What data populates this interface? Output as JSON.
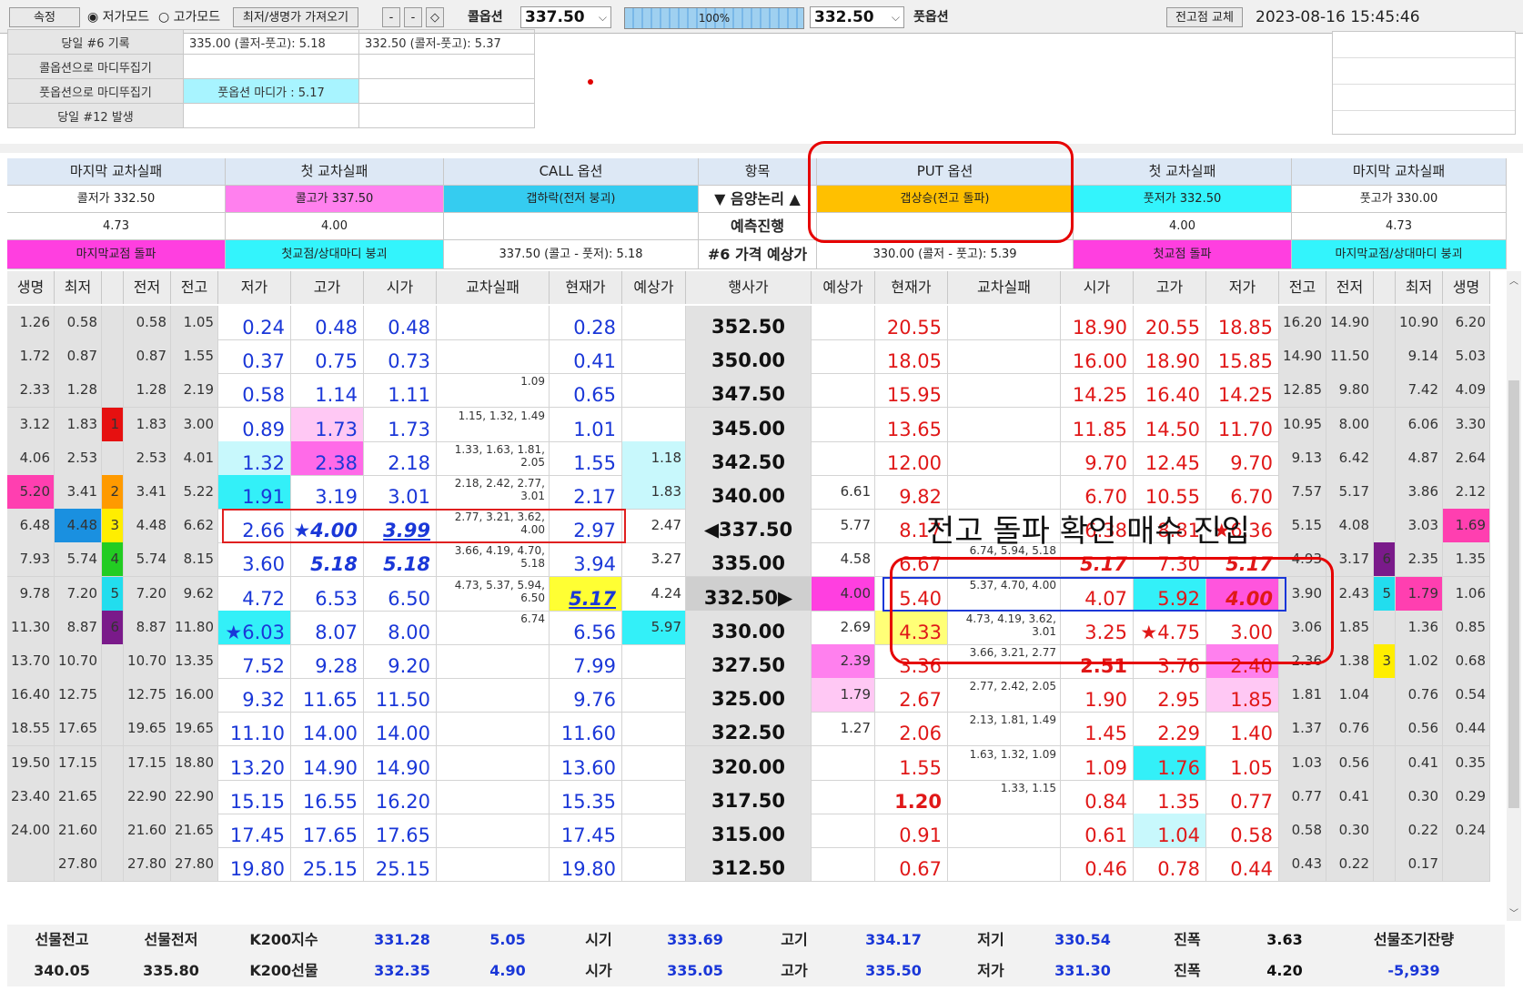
{
  "toolbar": {
    "button_left": "속정",
    "mode1": "저가모드",
    "mode2": "고가모드",
    "load_button": "최저/생명가 가져오기",
    "small_buttons": [
      "-",
      "-",
      "◇"
    ],
    "call_label": "콜옵션",
    "call_value": "337.50",
    "progress": "100%",
    "put_value": "332.50",
    "put_label": "풋옵션",
    "right_button": "전고점 교체",
    "datetime": "2023-08-16 15:45:46"
  },
  "info_table": {
    "rows": [
      {
        "label": "당일 #6 기록",
        "v1": "335.00 (콜저-풋고): 5.18",
        "v2": "332.50 (콜저-풋고): 5.37"
      },
      {
        "label": "콜옵션으로 마디뚜집기",
        "v1": "",
        "v2": ""
      },
      {
        "label": "풋옵션으로 마디뚜집기",
        "v1": "풋옵션 마디가 : 5.17",
        "v2": ""
      },
      {
        "label": "당일 #12 발생",
        "v1": "",
        "v2": ""
      }
    ]
  },
  "bands": {
    "col_titles": [
      "마지막 교차실패",
      "첫 교차실패",
      "CALL 옵션",
      "항목",
      "PUT 옵션",
      "첫 교차실패",
      "마지막 교차실패"
    ],
    "row2": [
      "콜저가 332.50",
      "콜고가 337.50",
      "갭하락(전저 붕괴)",
      "▼ 음양논리 ▲",
      "갭상승(전고 돌파)",
      "풋저가 332.50",
      "풋고가 330.00"
    ],
    "row3": [
      "4.73",
      "4.00",
      "",
      "예측진행",
      "",
      "4.00",
      "4.73"
    ],
    "row4": [
      "마지막교점 돌파",
      "첫교점/상대마디 붕괴",
      "337.50 (콜고 - 풋저): 5.18",
      "#6 가격 예상가",
      "330.00 (콜저 - 풋고): 5.39",
      "첫교점 돌파",
      "마지막교점/상대마디 붕괴"
    ]
  },
  "columns": [
    "생명",
    "최저",
    "",
    "전저",
    "전고",
    "저가",
    "고가",
    "시가",
    "교차실패",
    "현재가",
    "예상가",
    "행사가",
    "예상가",
    "현재가",
    "교차실패",
    "시가",
    "고가",
    "저가",
    "전고",
    "전저",
    "",
    "최저",
    "생명"
  ],
  "rows": [
    {
      "c_life": "1.26",
      "c_min": "0.58",
      "c_flag": "",
      "c_pl": "0.58",
      "c_ph": "1.05",
      "c_low": "0.24",
      "c_high": "0.48",
      "c_open": "0.48",
      "c_cross": "",
      "c_cur": "0.28",
      "c_exp": "",
      "strike": "352.50",
      "p_exp": "",
      "p_cur": "20.55",
      "p_cross": "",
      "p_open": "18.90",
      "p_high": "20.55",
      "p_low": "18.85",
      "p_ph": "16.20",
      "p_pl": "14.90",
      "p_flag": "",
      "p_min": "10.90",
      "p_life": "6.20"
    },
    {
      "c_life": "1.72",
      "c_min": "0.87",
      "c_flag": "",
      "c_pl": "0.87",
      "c_ph": "1.55",
      "c_low": "0.37",
      "c_high": "0.75",
      "c_open": "0.73",
      "c_cross": "",
      "c_cur": "0.41",
      "c_exp": "",
      "strike": "350.00",
      "p_exp": "",
      "p_cur": "18.05",
      "p_cross": "",
      "p_open": "16.00",
      "p_high": "18.90",
      "p_low": "15.85",
      "p_ph": "14.90",
      "p_pl": "11.50",
      "p_flag": "",
      "p_min": "9.14",
      "p_life": "5.03"
    },
    {
      "c_life": "2.33",
      "c_min": "1.28",
      "c_flag": "",
      "c_pl": "1.28",
      "c_ph": "2.19",
      "c_low": "0.58",
      "c_high": "1.14",
      "c_open": "1.11",
      "c_cross": "1.09",
      "c_cur": "0.65",
      "c_exp": "",
      "strike": "347.50",
      "p_exp": "",
      "p_cur": "15.95",
      "p_cross": "",
      "p_open": "14.25",
      "p_high": "16.40",
      "p_low": "14.25",
      "p_ph": "12.85",
      "p_pl": "9.80",
      "p_flag": "",
      "p_min": "7.42",
      "p_life": "4.09"
    },
    {
      "c_life": "3.12",
      "c_min": "1.83",
      "c_flag": "1",
      "c_pl": "1.83",
      "c_ph": "3.00",
      "c_low": "0.89",
      "c_high": "1.73",
      "c_open": "1.73",
      "c_cross": "1.15, 1.32, 1.49",
      "c_cur": "1.01",
      "c_exp": "",
      "strike": "345.00",
      "p_exp": "",
      "p_cur": "13.65",
      "p_cross": "",
      "p_open": "11.85",
      "p_high": "14.50",
      "p_low": "11.70",
      "p_ph": "10.95",
      "p_pl": "8.00",
      "p_flag": "",
      "p_min": "6.06",
      "p_life": "3.30"
    },
    {
      "c_life": "4.06",
      "c_min": "2.53",
      "c_flag": "",
      "c_pl": "2.53",
      "c_ph": "4.01",
      "c_low": "1.32",
      "c_high": "2.38",
      "c_open": "2.18",
      "c_cross": "1.33, 1.63, 1.81, 2.05",
      "c_cur": "1.55",
      "c_exp": "1.18",
      "strike": "342.50",
      "p_exp": "",
      "p_cur": "12.00",
      "p_cross": "",
      "p_open": "9.70",
      "p_high": "12.45",
      "p_low": "9.70",
      "p_ph": "9.13",
      "p_pl": "6.42",
      "p_flag": "",
      "p_min": "4.87",
      "p_life": "2.64"
    },
    {
      "c_life": "5.20",
      "c_min": "3.41",
      "c_flag": "2",
      "c_pl": "3.41",
      "c_ph": "5.22",
      "c_low": "1.91",
      "c_high": "3.19",
      "c_open": "3.01",
      "c_cross": "2.18, 2.42, 2.77, 3.01",
      "c_cur": "2.17",
      "c_exp": "1.83",
      "strike": "340.00",
      "p_exp": "6.61",
      "p_cur": "9.82",
      "p_cross": "",
      "p_open": "6.70",
      "p_high": "10.55",
      "p_low": "6.70",
      "p_ph": "7.57",
      "p_pl": "5.17",
      "p_flag": "",
      "p_min": "3.86",
      "p_life": "2.12"
    },
    {
      "c_life": "6.48",
      "c_min": "4.48",
      "c_flag": "3",
      "c_pl": "4.48",
      "c_ph": "6.62",
      "c_low": "2.66",
      "c_high": "★4.00",
      "c_open": "3.99",
      "c_cross": "2.77, 3.21, 3.62, 4.00",
      "c_cur": "2.97",
      "c_exp": "2.47",
      "strike": "◀337.50",
      "p_exp": "5.77",
      "p_cur": "8.17",
      "p_cross": "",
      "p_open": "6.38",
      "p_high": "8.81",
      "p_low": "★6.36",
      "p_ph": "5.15",
      "p_pl": "4.08",
      "p_flag": "",
      "p_min": "3.03",
      "p_life": "1.69"
    },
    {
      "c_life": "7.93",
      "c_min": "5.74",
      "c_flag": "4",
      "c_pl": "5.74",
      "c_ph": "8.15",
      "c_low": "3.60",
      "c_high": "5.18",
      "c_open": "5.18",
      "c_cross": "3.66, 4.19, 4.70, 5.18",
      "c_cur": "3.94",
      "c_exp": "3.27",
      "strike": "335.00",
      "p_exp": "4.58",
      "p_cur": "6.67",
      "p_cross": "6.74, 5.94, 5.18",
      "p_open": "5.17",
      "p_high": "7.30",
      "p_low": "5.17",
      "p_ph": "4.93",
      "p_pl": "3.17",
      "p_flag": "6",
      "p_min": "2.35",
      "p_life": "1.35"
    },
    {
      "c_life": "9.78",
      "c_min": "7.20",
      "c_flag": "5",
      "c_pl": "7.20",
      "c_ph": "9.62",
      "c_low": "4.72",
      "c_high": "6.53",
      "c_open": "6.50",
      "c_cross": "4.73, 5.37, 5.94, 6.50",
      "c_cur": "5.17",
      "c_exp": "4.24",
      "strike": "332.50▶",
      "p_exp": "4.00",
      "p_cur": "5.40",
      "p_cross": "5.37, 4.70, 4.00",
      "p_open": "4.07",
      "p_high": "5.92",
      "p_low": "4.00",
      "p_ph": "3.90",
      "p_pl": "2.43",
      "p_flag": "5",
      "p_min": "1.79",
      "p_life": "1.06"
    },
    {
      "c_life": "11.30",
      "c_min": "8.87",
      "c_flag": "6",
      "c_pl": "8.87",
      "c_ph": "11.80",
      "c_low": "★6.03",
      "c_high": "8.07",
      "c_open": "8.00",
      "c_cross": "6.74",
      "c_cur": "6.56",
      "c_exp": "5.97",
      "strike": "330.00",
      "p_exp": "2.69",
      "p_cur": "4.33",
      "p_cross": "4.73, 4.19, 3.62, 3.01",
      "p_open": "3.25",
      "p_high": "★4.75",
      "p_low": "3.00",
      "p_ph": "3.06",
      "p_pl": "1.85",
      "p_flag": "",
      "p_min": "1.36",
      "p_life": "0.85"
    },
    {
      "c_life": "13.70",
      "c_min": "10.70",
      "c_flag": "",
      "c_pl": "10.70",
      "c_ph": "13.35",
      "c_low": "7.52",
      "c_high": "9.28",
      "c_open": "9.20",
      "c_cross": "",
      "c_cur": "7.99",
      "c_exp": "",
      "strike": "327.50",
      "p_exp": "2.39",
      "p_cur": "3.36",
      "p_cross": "3.66, 3.21, 2.77",
      "p_open": "2.51",
      "p_high": "3.76",
      "p_low": "2.40",
      "p_ph": "2.36",
      "p_pl": "1.38",
      "p_flag": "3",
      "p_min": "1.02",
      "p_life": "0.68"
    },
    {
      "c_life": "16.40",
      "c_min": "12.75",
      "c_flag": "",
      "c_pl": "12.75",
      "c_ph": "16.00",
      "c_low": "9.32",
      "c_high": "11.65",
      "c_open": "11.50",
      "c_cross": "",
      "c_cur": "9.76",
      "c_exp": "",
      "strike": "325.00",
      "p_exp": "1.79",
      "p_cur": "2.67",
      "p_cross": "2.77, 2.42, 2.05",
      "p_open": "1.90",
      "p_high": "2.95",
      "p_low": "1.85",
      "p_ph": "1.81",
      "p_pl": "1.04",
      "p_flag": "",
      "p_min": "0.76",
      "p_life": "0.54"
    },
    {
      "c_life": "18.55",
      "c_min": "17.65",
      "c_flag": "",
      "c_pl": "19.65",
      "c_ph": "19.65",
      "c_low": "11.10",
      "c_high": "14.00",
      "c_open": "14.00",
      "c_cross": "",
      "c_cur": "11.60",
      "c_exp": "",
      "strike": "322.50",
      "p_exp": "1.27",
      "p_cur": "2.06",
      "p_cross": "2.13, 1.81, 1.49",
      "p_open": "1.45",
      "p_high": "2.29",
      "p_low": "1.40",
      "p_ph": "1.37",
      "p_pl": "0.76",
      "p_flag": "",
      "p_min": "0.56",
      "p_life": "0.44"
    },
    {
      "c_life": "19.50",
      "c_min": "17.15",
      "c_flag": "",
      "c_pl": "17.15",
      "c_ph": "18.80",
      "c_low": "13.20",
      "c_high": "14.90",
      "c_open": "14.90",
      "c_cross": "",
      "c_cur": "13.60",
      "c_exp": "",
      "strike": "320.00",
      "p_exp": "",
      "p_cur": "1.55",
      "p_cross": "1.63, 1.32, 1.09",
      "p_open": "1.09",
      "p_high": "1.76",
      "p_low": "1.05",
      "p_ph": "1.03",
      "p_pl": "0.56",
      "p_flag": "",
      "p_min": "0.41",
      "p_life": "0.35"
    },
    {
      "c_life": "23.40",
      "c_min": "21.65",
      "c_flag": "",
      "c_pl": "22.90",
      "c_ph": "22.90",
      "c_low": "15.15",
      "c_high": "16.55",
      "c_open": "16.20",
      "c_cross": "",
      "c_cur": "15.35",
      "c_exp": "",
      "strike": "317.50",
      "p_exp": "",
      "p_cur": "1.20",
      "p_cross": "1.33, 1.15",
      "p_open": "0.84",
      "p_high": "1.35",
      "p_low": "0.77",
      "p_ph": "0.77",
      "p_pl": "0.41",
      "p_flag": "",
      "p_min": "0.30",
      "p_life": "0.29"
    },
    {
      "c_life": "24.00",
      "c_min": "21.60",
      "c_flag": "",
      "c_pl": "21.60",
      "c_ph": "21.65",
      "c_low": "17.45",
      "c_high": "17.65",
      "c_open": "17.65",
      "c_cross": "",
      "c_cur": "17.45",
      "c_exp": "",
      "strike": "315.00",
      "p_exp": "",
      "p_cur": "0.91",
      "p_cross": "",
      "p_open": "0.61",
      "p_high": "1.04",
      "p_low": "0.58",
      "p_ph": "0.58",
      "p_pl": "0.30",
      "p_flag": "",
      "p_min": "0.22",
      "p_life": "0.24"
    },
    {
      "c_life": "",
      "c_min": "27.80",
      "c_flag": "",
      "c_pl": "27.80",
      "c_ph": "27.80",
      "c_low": "19.80",
      "c_high": "25.15",
      "c_open": "25.15",
      "c_cross": "",
      "c_cur": "19.80",
      "c_exp": "",
      "strike": "312.50",
      "p_exp": "",
      "p_cur": "0.67",
      "p_cross": "",
      "p_open": "0.46",
      "p_high": "0.78",
      "p_low": "0.44",
      "p_ph": "0.43",
      "p_pl": "0.22",
      "p_flag": "",
      "p_min": "0.17",
      "p_life": ""
    }
  ],
  "bottom": {
    "row1": [
      "선물전고",
      "선물전저",
      "K200지수",
      "331.28",
      "5.05",
      "시기",
      "333.69",
      "고기",
      "334.17",
      "저기",
      "330.54",
      "진폭",
      "3.63",
      "선물조기잔량"
    ],
    "row2": [
      "340.05",
      "335.80",
      "K200선물",
      "332.35",
      "4.90",
      "시가",
      "335.05",
      "고가",
      "335.50",
      "저가",
      "331.30",
      "진폭",
      "4.20",
      "-5,939"
    ]
  },
  "annotation": {
    "text": "전고 돌파 확인 매수 진입",
    "color": "#e60000"
  },
  "colors": {
    "blue_text": "#1a37d8",
    "red_text": "#e01818",
    "magenta": "#ff55dd",
    "cyan": "#33f0f8",
    "orange": "#ffc000",
    "pink_light": "#ffc8f4",
    "cyan_light": "#c8f8fc",
    "yellow": "#ffff33"
  }
}
